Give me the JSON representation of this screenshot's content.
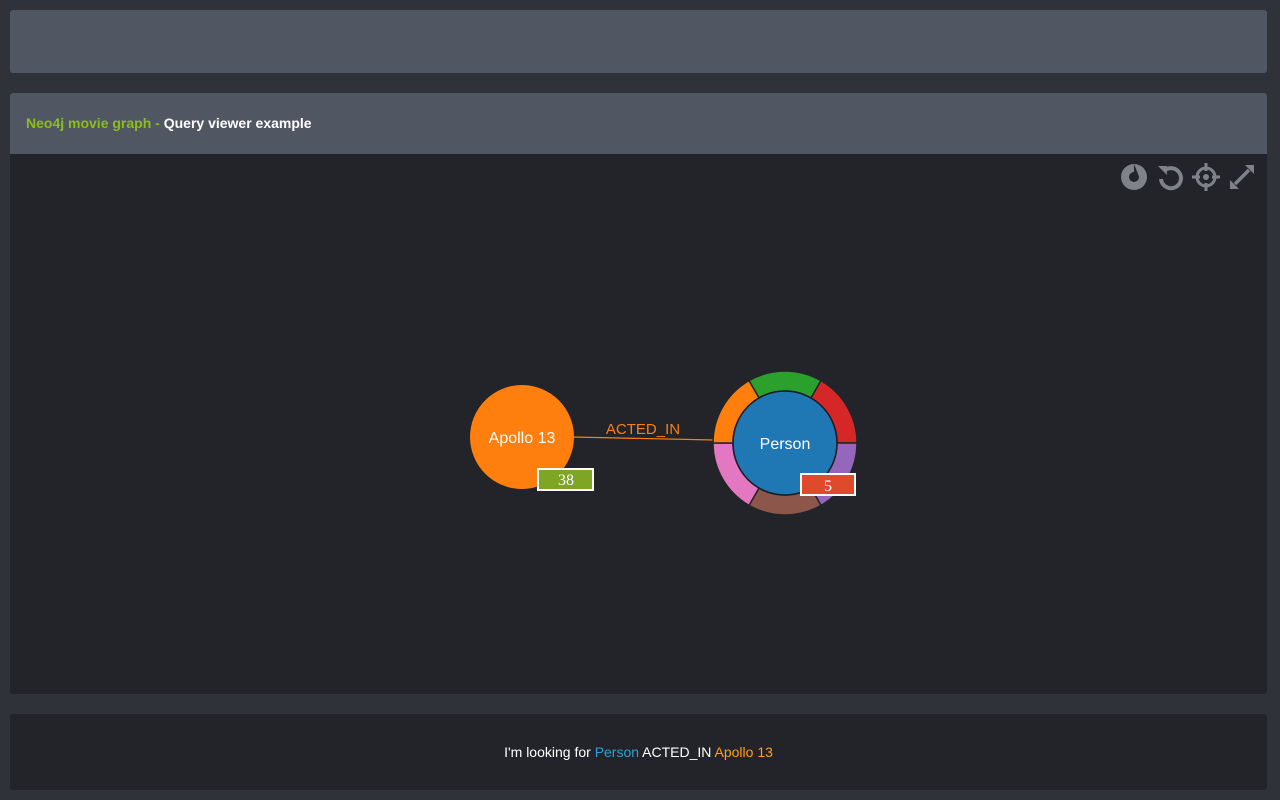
{
  "header": {
    "brand": "Neo4j movie graph",
    "separator": " - ",
    "subtitle": "Query viewer example"
  },
  "toolbar": {
    "buttons": [
      {
        "name": "popoto-icon"
      },
      {
        "name": "reset-icon"
      },
      {
        "name": "center-icon"
      },
      {
        "name": "fullscreen-icon"
      }
    ],
    "icon_color": "#7f8389"
  },
  "graph": {
    "root_node": {
      "label": "Apollo 13",
      "count": "38",
      "color": "#ff7f0e",
      "badge_color": "#7ea624"
    },
    "target_node": {
      "label": "Person",
      "count": "5",
      "color": "#1f77b4",
      "badge_color": "#de4a2b"
    },
    "relationship": {
      "label": "ACTED_IN",
      "color": "#ff7f0e"
    },
    "ring_colors": [
      "#2ca02c",
      "#d62728",
      "#9467bd",
      "#8c564b",
      "#e377c2",
      "#ff7f0e"
    ]
  },
  "query": {
    "prefix": "I'm looking for ",
    "target": "Person",
    "relation": " ACTED_IN ",
    "root": "Apollo 13"
  }
}
